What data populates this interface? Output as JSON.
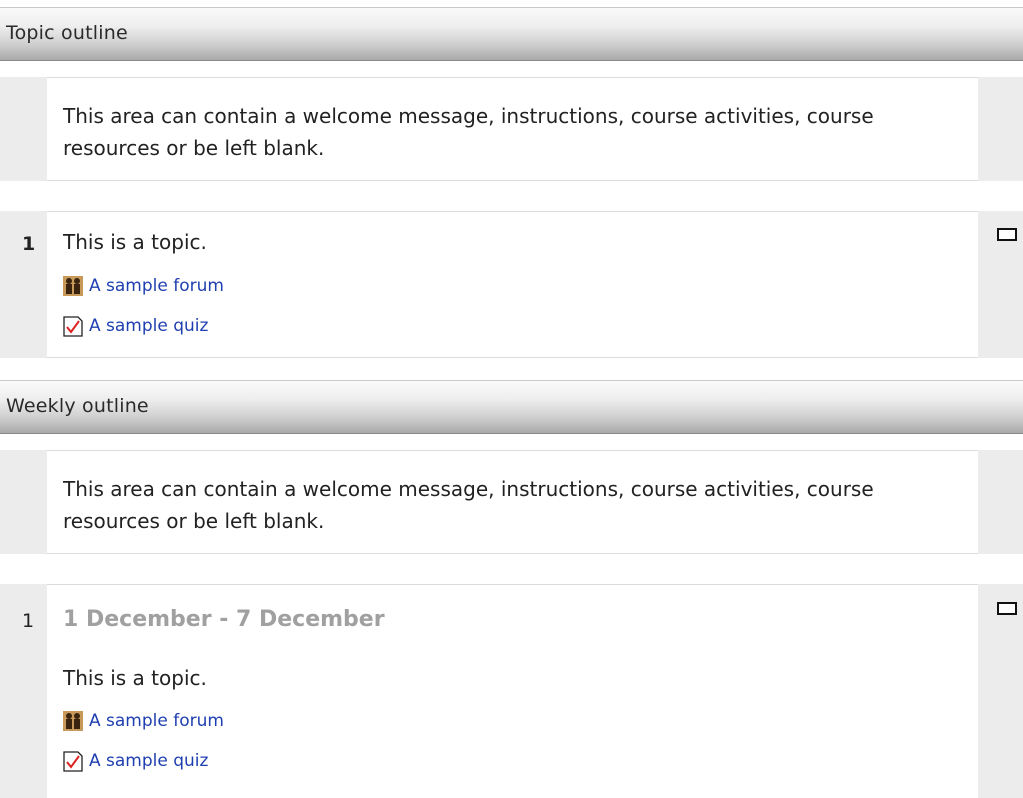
{
  "topic_outline": {
    "header": "Topic outline",
    "summary": "This area can contain a welcome message, instructions, course activities, course resources or be left blank.",
    "topic": {
      "number": "1",
      "text": "This is a topic.",
      "activities": [
        {
          "label": "A sample forum",
          "icon": "forum-icon"
        },
        {
          "label": "A sample quiz",
          "icon": "quiz-icon"
        }
      ]
    }
  },
  "weekly_outline": {
    "header": "Weekly outline",
    "summary": "This area can contain a welcome message, instructions, course activities, course resources or be left blank.",
    "week": {
      "number": "1",
      "title": "1 December - 7 December",
      "text": "This is a topic.",
      "activities": [
        {
          "label": "A sample forum",
          "icon": "forum-icon"
        },
        {
          "label": "A sample quiz",
          "icon": "quiz-icon"
        }
      ]
    }
  },
  "colors": {
    "link": "#1f3fb0",
    "side_panel": "#ececec",
    "week_title": "#a0a0a0"
  }
}
